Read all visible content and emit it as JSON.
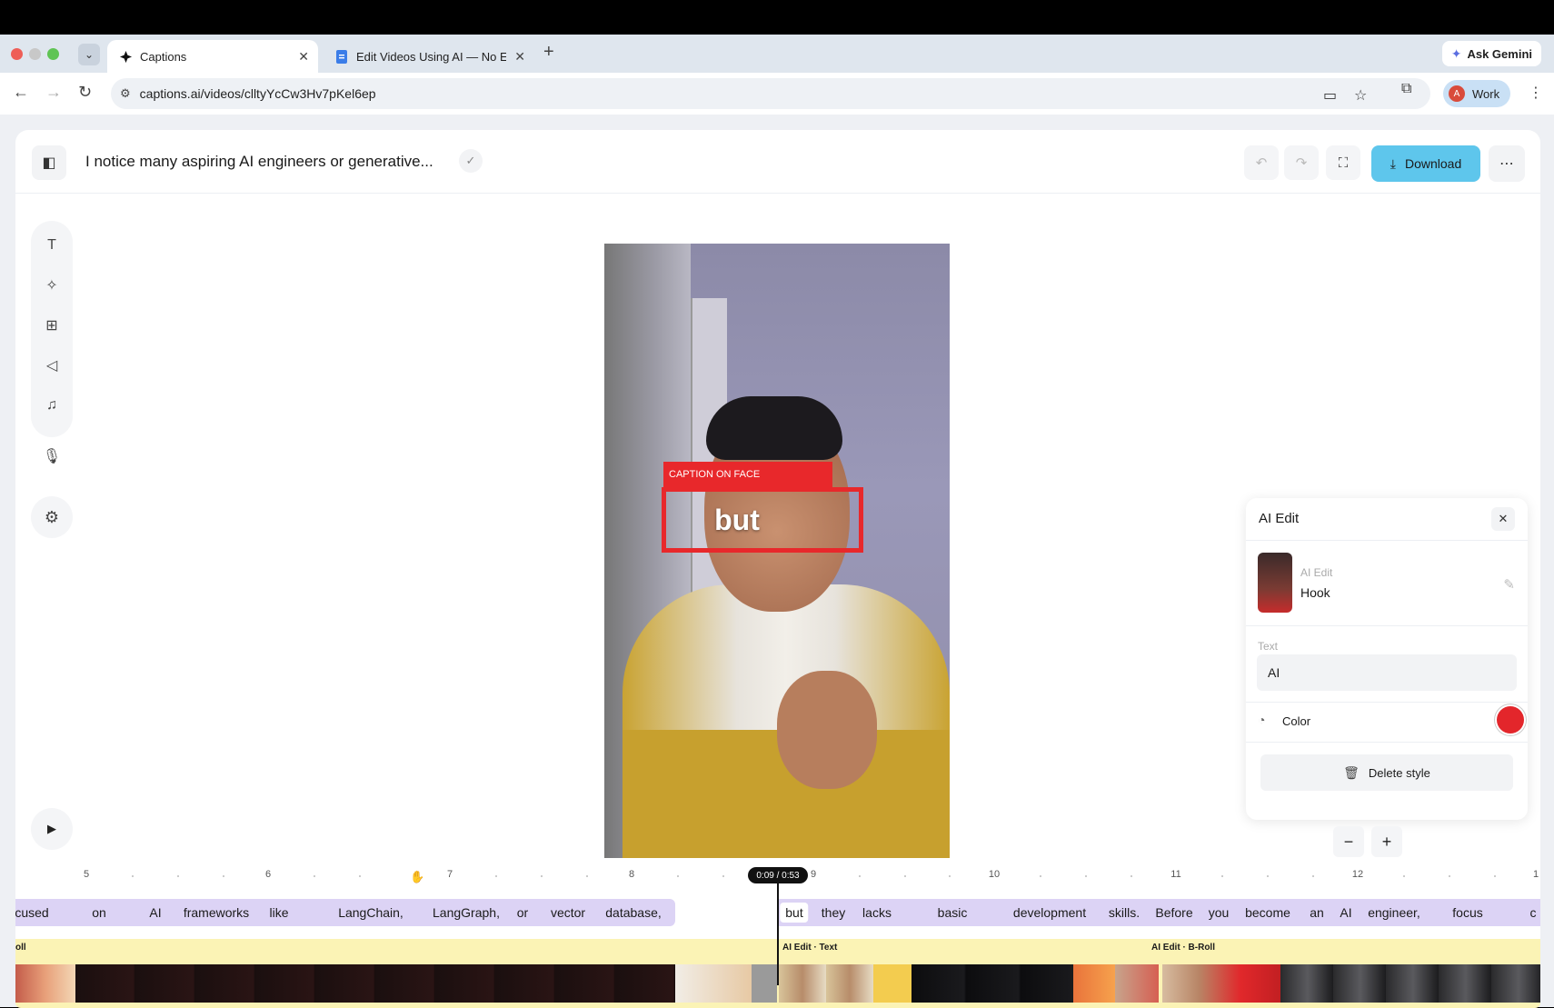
{
  "browser": {
    "tabs": [
      {
        "label": "Captions",
        "active": true
      },
      {
        "label": "Edit Videos Using AI — No Ed",
        "active": false
      }
    ],
    "ask_gemini": "Ask Gemini",
    "url": "captions.ai/videos/clltyYcCw3Hv7pKel6ep",
    "profile_initial": "A",
    "profile_label": "Work"
  },
  "header": {
    "title": "I notice many aspiring AI engineers or generative...",
    "download_label": "Download"
  },
  "video": {
    "caption_tag": "CAPTION ON FACE",
    "caption_word": "but"
  },
  "ai_edit_panel": {
    "title": "AI Edit",
    "style_label": "AI Edit",
    "style_value": "Hook",
    "text_label": "Text",
    "text_value": "AI",
    "color_label": "Color",
    "color_value": "#e3262b",
    "delete_label": "Delete style"
  },
  "timeline": {
    "time_badge": "0:09 / 0:53",
    "ruler_ticks": [
      "5",
      "6",
      "7",
      "8",
      "9",
      "10",
      "11",
      "12",
      "1"
    ],
    "words_before": [
      "cused",
      "on",
      "AI",
      "frameworks",
      "like",
      "LangChain,",
      "LangGraph,",
      "or",
      "vector",
      "database,"
    ],
    "words_after": [
      "but",
      "they",
      "lacks",
      "basic",
      "development",
      "skills.",
      "Before",
      "you",
      "become",
      "an",
      "AI",
      "engineer,",
      "focus",
      "c"
    ],
    "clip_labels": [
      "oll",
      "AI Edit · Text",
      "AI Edit · B-Roll"
    ]
  }
}
